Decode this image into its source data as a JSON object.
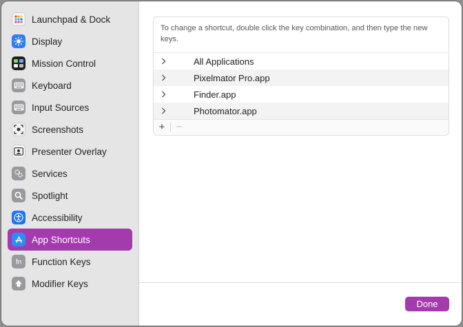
{
  "sidebar": {
    "items": [
      {
        "label": "Launchpad & Dock",
        "icon": "launchpad-icon"
      },
      {
        "label": "Display",
        "icon": "display-icon"
      },
      {
        "label": "Mission Control",
        "icon": "mission-control-icon"
      },
      {
        "label": "Keyboard",
        "icon": "keyboard-icon"
      },
      {
        "label": "Input Sources",
        "icon": "input-sources-icon"
      },
      {
        "label": "Screenshots",
        "icon": "screenshots-icon"
      },
      {
        "label": "Presenter Overlay",
        "icon": "presenter-overlay-icon"
      },
      {
        "label": "Services",
        "icon": "services-icon"
      },
      {
        "label": "Spotlight",
        "icon": "spotlight-icon"
      },
      {
        "label": "Accessibility",
        "icon": "accessibility-icon"
      },
      {
        "label": "App Shortcuts",
        "icon": "app-shortcuts-icon",
        "selected": true
      },
      {
        "label": "Function Keys",
        "icon": "function-keys-icon"
      },
      {
        "label": "Modifier Keys",
        "icon": "modifier-keys-icon"
      }
    ]
  },
  "main": {
    "instructions": "To change a shortcut, double click the key combination, and then type the new keys.",
    "rows": [
      {
        "name": "All Applications"
      },
      {
        "name": "Pixelmator Pro.app"
      },
      {
        "name": "Finder.app"
      },
      {
        "name": "Photomator.app"
      }
    ],
    "toolbar": {
      "add": "+",
      "remove": "−"
    },
    "done_label": "Done"
  },
  "colors": {
    "accent": "#a33bad",
    "sidebar_bg": "#e5e5e5"
  }
}
